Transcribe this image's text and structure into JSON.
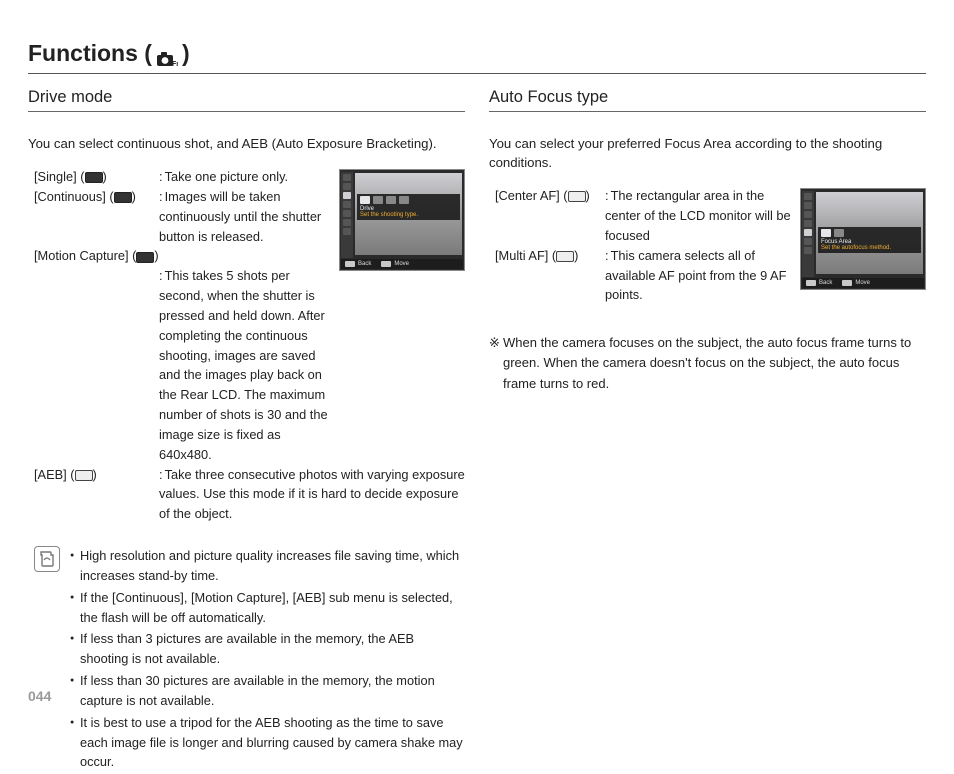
{
  "page_title_prefix": "Functions (",
  "page_title_suffix": " )",
  "page_number": "044",
  "left": {
    "section_title": "Drive mode",
    "intro": "You can select continuous shot, and AEB (Auto Exposure Bracketing).",
    "items": [
      {
        "label": "[Single] (",
        "icon": "single-icon",
        "label_close": ")",
        "desc": "Take one picture only."
      },
      {
        "label": "[Continuous] (",
        "icon": "continuous-icon",
        "label_close": ")",
        "desc": "Images will be taken continuously until the shutter button is released."
      },
      {
        "label": "[Motion Capture] (",
        "icon": "motion-icon",
        "label_close": ")",
        "desc": "This takes 5 shots per second, when the shutter is pressed and held down. After completing the continuous shooting, images are saved and the images play back on the Rear LCD. The maximum number of shots is 30 and the image size is fixed as 640x480."
      },
      {
        "label": "[AEB] (",
        "icon": "aeb-icon",
        "label_close": ")",
        "desc": "Take three consecutive photos with varying exposure values. Use this mode if it is hard to decide exposure of the object."
      }
    ],
    "notes": [
      "High resolution and picture quality increases file saving time, which increases stand-by time.",
      "If the [Continuous], [Motion Capture], [AEB] sub menu is selected, the flash will be off automatically.",
      "If less than 3 pictures are available in the memory, the AEB shooting is not available.",
      "If less than 30 pictures are available in the memory, the motion capture is not available.",
      "It is best to use a tripod for the AEB shooting as the time to save each image file is longer and blurring caused by camera shake may occur."
    ],
    "preview": {
      "band_title": "Drive",
      "band_sub": "Set the shooting type.",
      "footer_back": "Back",
      "footer_move": "Move"
    }
  },
  "right": {
    "section_title": "Auto Focus type",
    "intro": "You can select your preferred Focus Area according to the shooting conditions.",
    "items": [
      {
        "label": "[Center AF] (",
        "icon": "center-af-icon",
        "label_close": ")",
        "desc": "The rectangular area in the center of the LCD monitor will be focused"
      },
      {
        "label": "[Multi AF] (",
        "icon": "multi-af-icon",
        "label_close": ")",
        "desc": "This camera selects all of available AF point from the 9 AF points."
      }
    ],
    "star_note": "When the camera focuses on the subject, the auto focus frame turns to green. When the camera doesn't focus on the subject, the auto focus frame turns to red.",
    "preview": {
      "band_title": "Focus Area",
      "band_sub": "Set the autofocus method.",
      "footer_back": "Back",
      "footer_move": "Move"
    }
  }
}
